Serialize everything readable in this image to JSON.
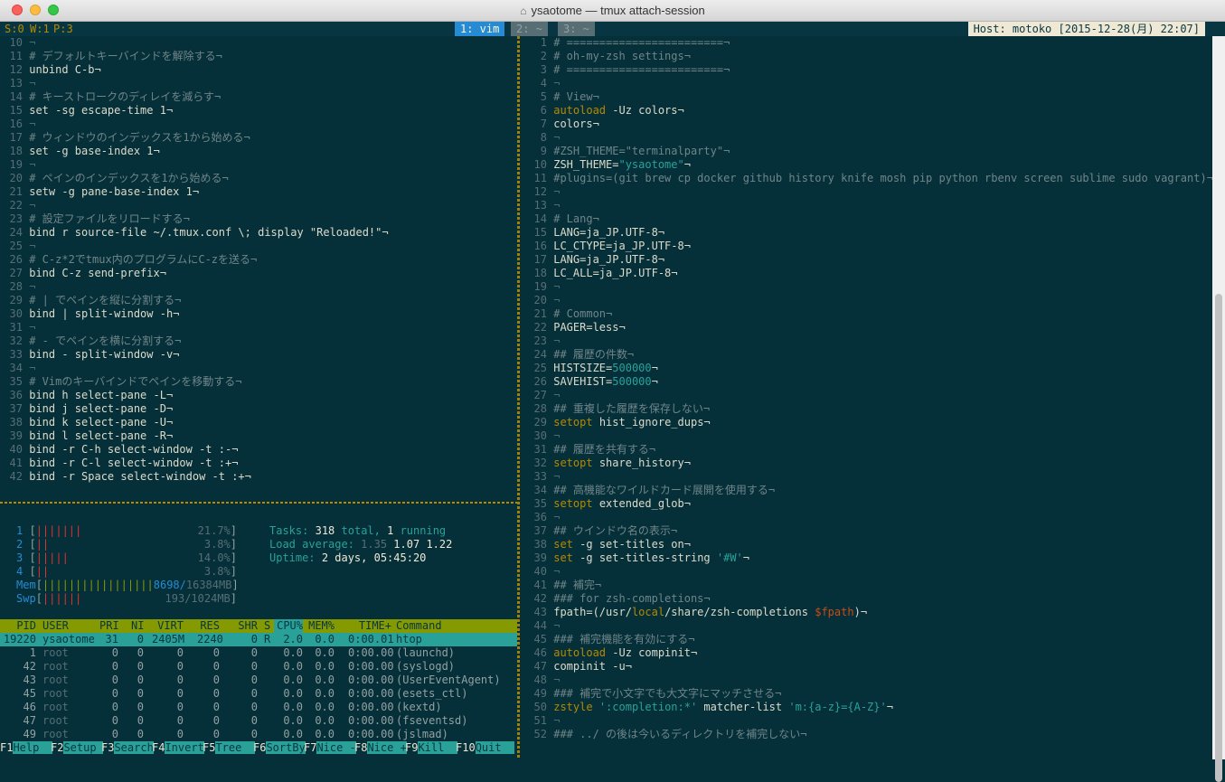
{
  "window": {
    "title": "ysaotome — tmux attach-session"
  },
  "tmux": {
    "session": "S:0",
    "window": "W:1",
    "pane": "P:3",
    "tabs": [
      {
        "label": "1: vim",
        "active": true
      },
      {
        "label": "2: ~",
        "active": false
      },
      {
        "label": "3: ~",
        "active": false
      }
    ],
    "host": "Host: motoko [2015-12-28(月) 22:07]"
  },
  "left_vim": [
    {
      "n": "10",
      "t": "¬",
      "s": "nl"
    },
    {
      "n": "11",
      "t": "# デフォルトキーバインドを解除する¬",
      "s": "cmt"
    },
    {
      "n": "12",
      "t": "unbind C-b¬",
      "s": "txt"
    },
    {
      "n": "13",
      "t": "¬",
      "s": "nl"
    },
    {
      "n": "14",
      "t": "# キーストロークのディレイを減らす¬",
      "s": "cmt"
    },
    {
      "n": "15",
      "t": "set -sg escape-time 1¬",
      "s": "txt"
    },
    {
      "n": "16",
      "t": "¬",
      "s": "nl"
    },
    {
      "n": "17",
      "t": "# ウィンドウのインデックスを1から始める¬",
      "s": "cmt"
    },
    {
      "n": "18",
      "t": "set -g base-index 1¬",
      "s": "txt"
    },
    {
      "n": "19",
      "t": "¬",
      "s": "nl"
    },
    {
      "n": "20",
      "t": "# ペインのインデックスを1から始める¬",
      "s": "cmt"
    },
    {
      "n": "21",
      "t": "setw -g pane-base-index 1¬",
      "s": "txt"
    },
    {
      "n": "22",
      "t": "¬",
      "s": "nl"
    },
    {
      "n": "23",
      "t": "# 設定ファイルをリロードする¬",
      "s": "cmt"
    },
    {
      "n": "24",
      "t": "bind r source-file ~/.tmux.conf \\; display \"Reloaded!\"¬",
      "s": "txt"
    },
    {
      "n": "25",
      "t": "¬",
      "s": "nl"
    },
    {
      "n": "26",
      "t": "# C-z*2でtmux内のプログラムにC-zを送る¬",
      "s": "cmt"
    },
    {
      "n": "27",
      "t": "bind C-z send-prefix¬",
      "s": "txt"
    },
    {
      "n": "28",
      "t": "¬",
      "s": "nl"
    },
    {
      "n": "29",
      "t": "# | でペインを縦に分割する¬",
      "s": "cmt"
    },
    {
      "n": "30",
      "t": "bind | split-window -h¬",
      "s": "txt"
    },
    {
      "n": "31",
      "t": "¬",
      "s": "nl"
    },
    {
      "n": "32",
      "t": "# - でペインを横に分割する¬",
      "s": "cmt"
    },
    {
      "n": "33",
      "t": "bind - split-window -v¬",
      "s": "txt"
    },
    {
      "n": "34",
      "t": "¬",
      "s": "nl"
    },
    {
      "n": "35",
      "t": "# Vimのキーバインドでペインを移動する¬",
      "s": "cmt"
    },
    {
      "n": "36",
      "t": "bind h select-pane -L¬",
      "s": "txt"
    },
    {
      "n": "37",
      "t": "bind j select-pane -D¬",
      "s": "txt"
    },
    {
      "n": "38",
      "t": "bind k select-pane -U¬",
      "s": "txt"
    },
    {
      "n": "39",
      "t": "bind l select-pane -R¬",
      "s": "txt"
    },
    {
      "n": "40",
      "t": "bind -r C-h select-window -t :-¬",
      "s": "txt"
    },
    {
      "n": "41",
      "t": "bind -r C-l select-window -t :+¬",
      "s": "txt"
    },
    {
      "n": "42",
      "t": "bind -r Space select-window -t :+¬",
      "s": "txt"
    }
  ],
  "right_vim": [
    {
      "n": "1",
      "t": "# ========================¬",
      "s": "cmt"
    },
    {
      "n": "2",
      "t": "# oh-my-zsh settings¬",
      "s": "cmt"
    },
    {
      "n": "3",
      "t": "# ========================¬",
      "s": "cmt"
    },
    {
      "n": "4",
      "t": "¬",
      "s": "nl"
    },
    {
      "n": "5",
      "t": "# View¬",
      "s": "cmt"
    },
    {
      "n": "6",
      "k": "autoload",
      "t": " -Uz colors¬",
      "s": "txt"
    },
    {
      "n": "7",
      "t": "colors¬",
      "s": "txt"
    },
    {
      "n": "8",
      "t": "¬",
      "s": "nl"
    },
    {
      "n": "9",
      "t": "#ZSH_THEME=\"terminalparty\"¬",
      "s": "cmt"
    },
    {
      "n": "10",
      "t": "ZSH_THEME=",
      "str": "\"ysaotome\"",
      "t2": "¬",
      "s": "txt"
    },
    {
      "n": "11",
      "t": "#plugins=(git brew cp docker github history knife mosh pip python rbenv screen sublime sudo vagrant)¬",
      "s": "cmt"
    },
    {
      "n": "12",
      "t": "¬",
      "s": "nl"
    },
    {
      "n": "13",
      "t": "¬",
      "s": "nl"
    },
    {
      "n": "14",
      "t": "# Lang¬",
      "s": "cmt"
    },
    {
      "n": "15",
      "t": "LANG=ja_JP.UTF-8¬",
      "s": "txt"
    },
    {
      "n": "16",
      "t": "LC_CTYPE=ja_JP.UTF-8¬",
      "s": "txt"
    },
    {
      "n": "17",
      "t": "LANG=ja_JP.UTF-8¬",
      "s": "txt"
    },
    {
      "n": "18",
      "t": "LC_ALL=ja_JP.UTF-8¬",
      "s": "txt"
    },
    {
      "n": "19",
      "t": "¬",
      "s": "nl"
    },
    {
      "n": "20",
      "t": "¬",
      "s": "nl"
    },
    {
      "n": "21",
      "t": "# Common¬",
      "s": "cmt"
    },
    {
      "n": "22",
      "t": "PAGER=less¬",
      "s": "txt"
    },
    {
      "n": "23",
      "t": "¬",
      "s": "nl"
    },
    {
      "n": "24",
      "t": "## 履歴の件数¬",
      "s": "cmt"
    },
    {
      "n": "25",
      "t": "HISTSIZE=",
      "num": "500000",
      "t2": "¬",
      "s": "txt"
    },
    {
      "n": "26",
      "t": "SAVEHIST=",
      "num": "500000",
      "t2": "¬",
      "s": "txt"
    },
    {
      "n": "27",
      "t": "¬",
      "s": "nl"
    },
    {
      "n": "28",
      "t": "## 重複した履歴を保存しない¬",
      "s": "cmt"
    },
    {
      "n": "29",
      "k": "setopt",
      "t": " hist_ignore_dups¬",
      "s": "txt"
    },
    {
      "n": "30",
      "t": "¬",
      "s": "nl"
    },
    {
      "n": "31",
      "t": "## 履歴を共有する¬",
      "s": "cmt"
    },
    {
      "n": "32",
      "k": "setopt",
      "t": " share_history¬",
      "s": "txt"
    },
    {
      "n": "33",
      "t": "¬",
      "s": "nl"
    },
    {
      "n": "34",
      "t": "## 高機能なワイルドカード展開を使用する¬",
      "s": "cmt"
    },
    {
      "n": "35",
      "k": "setopt",
      "t": " extended_glob¬",
      "s": "txt"
    },
    {
      "n": "36",
      "t": "¬",
      "s": "nl"
    },
    {
      "n": "37",
      "t": "## ウインドウ名の表示¬",
      "s": "cmt"
    },
    {
      "n": "38",
      "k": "set",
      "t": " -g set-titles on¬",
      "s": "txt"
    },
    {
      "n": "39",
      "k": "set",
      "t": " -g set-titles-string ",
      "str": "'#W'",
      "t2": "¬",
      "s": "txt"
    },
    {
      "n": "40",
      "t": "¬",
      "s": "nl"
    },
    {
      "n": "41",
      "t": "## 補完¬",
      "s": "cmt"
    },
    {
      "n": "42",
      "t": "### for zsh-completions¬",
      "s": "cmt"
    },
    {
      "n": "43",
      "t": "fpath=(/usr/",
      "kw2": "local",
      "t2": "/share/zsh-completions ",
      "var": "$fpath",
      "t3": ")¬",
      "s": "txt"
    },
    {
      "n": "44",
      "t": "¬",
      "s": "nl"
    },
    {
      "n": "45",
      "t": "### 補完機能を有効にする¬",
      "s": "cmt"
    },
    {
      "n": "46",
      "k": "autoload",
      "t": " -Uz compinit¬",
      "s": "txt"
    },
    {
      "n": "47",
      "t": "compinit -u¬",
      "s": "txt"
    },
    {
      "n": "48",
      "t": "¬",
      "s": "nl"
    },
    {
      "n": "49",
      "t": "### 補完で小文字でも大文字にマッチさせる¬",
      "s": "cmt"
    },
    {
      "n": "50",
      "k": "zstyle",
      "t": " ",
      "str": "':completion:*'",
      "t2": " matcher-list ",
      "str2": "'m:{a-z}={A-Z}'",
      "t3": "¬",
      "s": "txt"
    },
    {
      "n": "51",
      "t": "¬",
      "s": "nl"
    },
    {
      "n": "52",
      "t": "### ../ の後は今いるディレクトリを補完しない¬",
      "s": "cmt"
    }
  ],
  "htop": {
    "cpus": [
      {
        "label": "1",
        "bars": "|||||||",
        "value": "21.7%"
      },
      {
        "label": "2",
        "bars": "||",
        "value": "3.8%"
      },
      {
        "label": "3",
        "bars": "|||||",
        "value": "14.0%"
      },
      {
        "label": "4",
        "bars": "||",
        "value": "3.8%"
      }
    ],
    "mem": {
      "label": "Mem",
      "bars": "|||||||||||||||||",
      "used": "8698/",
      "total": "16384MB"
    },
    "swp": {
      "label": "Swp",
      "bars": "||||||",
      "value": "193/1024MB"
    },
    "tasks_label": "Tasks:",
    "tasks_value": "318",
    "tasks_total": "total,",
    "running_value": "1",
    "running_label": "running",
    "load_label": "Load average:",
    "load_1": "1.35",
    "load_5": "1.07",
    "load_15": "1.22",
    "uptime_label": "Uptime:",
    "uptime_value": "2 days, 05:45:20",
    "columns": [
      "PID",
      "USER",
      "PRI",
      "NI",
      "VIRT",
      "RES",
      "SHR",
      "S",
      "CPU%",
      "MEM%",
      "TIME+",
      "Command"
    ],
    "processes": [
      {
        "pid": "19220",
        "user": "ysaotome",
        "pri": "31",
        "ni": "0",
        "virt": "2405M",
        "res": "2240",
        "shr": "0",
        "s": "R",
        "cpu": "2.0",
        "mem": "0.0",
        "time": "0:00.01",
        "cmd": "htop",
        "selected": true
      },
      {
        "pid": "1",
        "user": "root",
        "pri": "0",
        "ni": "0",
        "virt": "0",
        "res": "0",
        "shr": "0",
        "s": "",
        "cpu": "0.0",
        "mem": "0.0",
        "time": "0:00.00",
        "cmd": "(launchd)"
      },
      {
        "pid": "42",
        "user": "root",
        "pri": "0",
        "ni": "0",
        "virt": "0",
        "res": "0",
        "shr": "0",
        "s": "",
        "cpu": "0.0",
        "mem": "0.0",
        "time": "0:00.00",
        "cmd": "(syslogd)"
      },
      {
        "pid": "43",
        "user": "root",
        "pri": "0",
        "ni": "0",
        "virt": "0",
        "res": "0",
        "shr": "0",
        "s": "",
        "cpu": "0.0",
        "mem": "0.0",
        "time": "0:00.00",
        "cmd": "(UserEventAgent)"
      },
      {
        "pid": "45",
        "user": "root",
        "pri": "0",
        "ni": "0",
        "virt": "0",
        "res": "0",
        "shr": "0",
        "s": "",
        "cpu": "0.0",
        "mem": "0.0",
        "time": "0:00.00",
        "cmd": "(esets_ctl)"
      },
      {
        "pid": "46",
        "user": "root",
        "pri": "0",
        "ni": "0",
        "virt": "0",
        "res": "0",
        "shr": "0",
        "s": "",
        "cpu": "0.0",
        "mem": "0.0",
        "time": "0:00.00",
        "cmd": "(kextd)"
      },
      {
        "pid": "47",
        "user": "root",
        "pri": "0",
        "ni": "0",
        "virt": "0",
        "res": "0",
        "shr": "0",
        "s": "",
        "cpu": "0.0",
        "mem": "0.0",
        "time": "0:00.00",
        "cmd": "(fseventsd)"
      },
      {
        "pid": "49",
        "user": "root",
        "pri": "0",
        "ni": "0",
        "virt": "0",
        "res": "0",
        "shr": "0",
        "s": "",
        "cpu": "0.0",
        "mem": "0.0",
        "time": "0:00.00",
        "cmd": "(jslmad)"
      }
    ],
    "fkeys": [
      {
        "k": "F1",
        "l": "Help  "
      },
      {
        "k": "F2",
        "l": "Setup "
      },
      {
        "k": "F3",
        "l": "Search"
      },
      {
        "k": "F4",
        "l": "Invert"
      },
      {
        "k": "F5",
        "l": "Tree  "
      },
      {
        "k": "F6",
        "l": "SortBy"
      },
      {
        "k": "F7",
        "l": "Nice -"
      },
      {
        "k": "F8",
        "l": "Nice +"
      },
      {
        "k": "F9",
        "l": "Kill  "
      },
      {
        "k": "F10",
        "l": "Quit  "
      }
    ]
  }
}
